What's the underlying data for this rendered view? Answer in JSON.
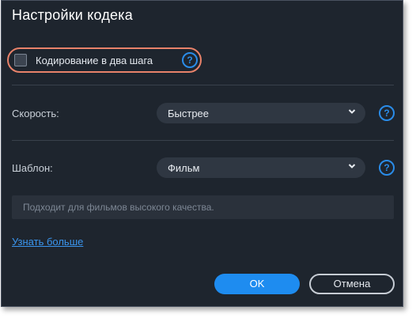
{
  "dialog": {
    "title": "Настройки кодека",
    "two_pass": {
      "label": "Кодирование в два шага",
      "checked": false,
      "help_icon": "question-icon"
    },
    "speed": {
      "label": "Скорость:",
      "value": "Быстрее"
    },
    "preset": {
      "label": "Шаблон:",
      "value": "Фильм"
    },
    "description": "Подходит для фильмов высокого качества.",
    "learn_more": "Узнать больше",
    "ok_label": "OK",
    "cancel_label": "Отмена",
    "help_glyph": "?"
  },
  "colors": {
    "background": "#1e252e",
    "accent": "#1e8cf0",
    "highlight": "#e8826a"
  }
}
